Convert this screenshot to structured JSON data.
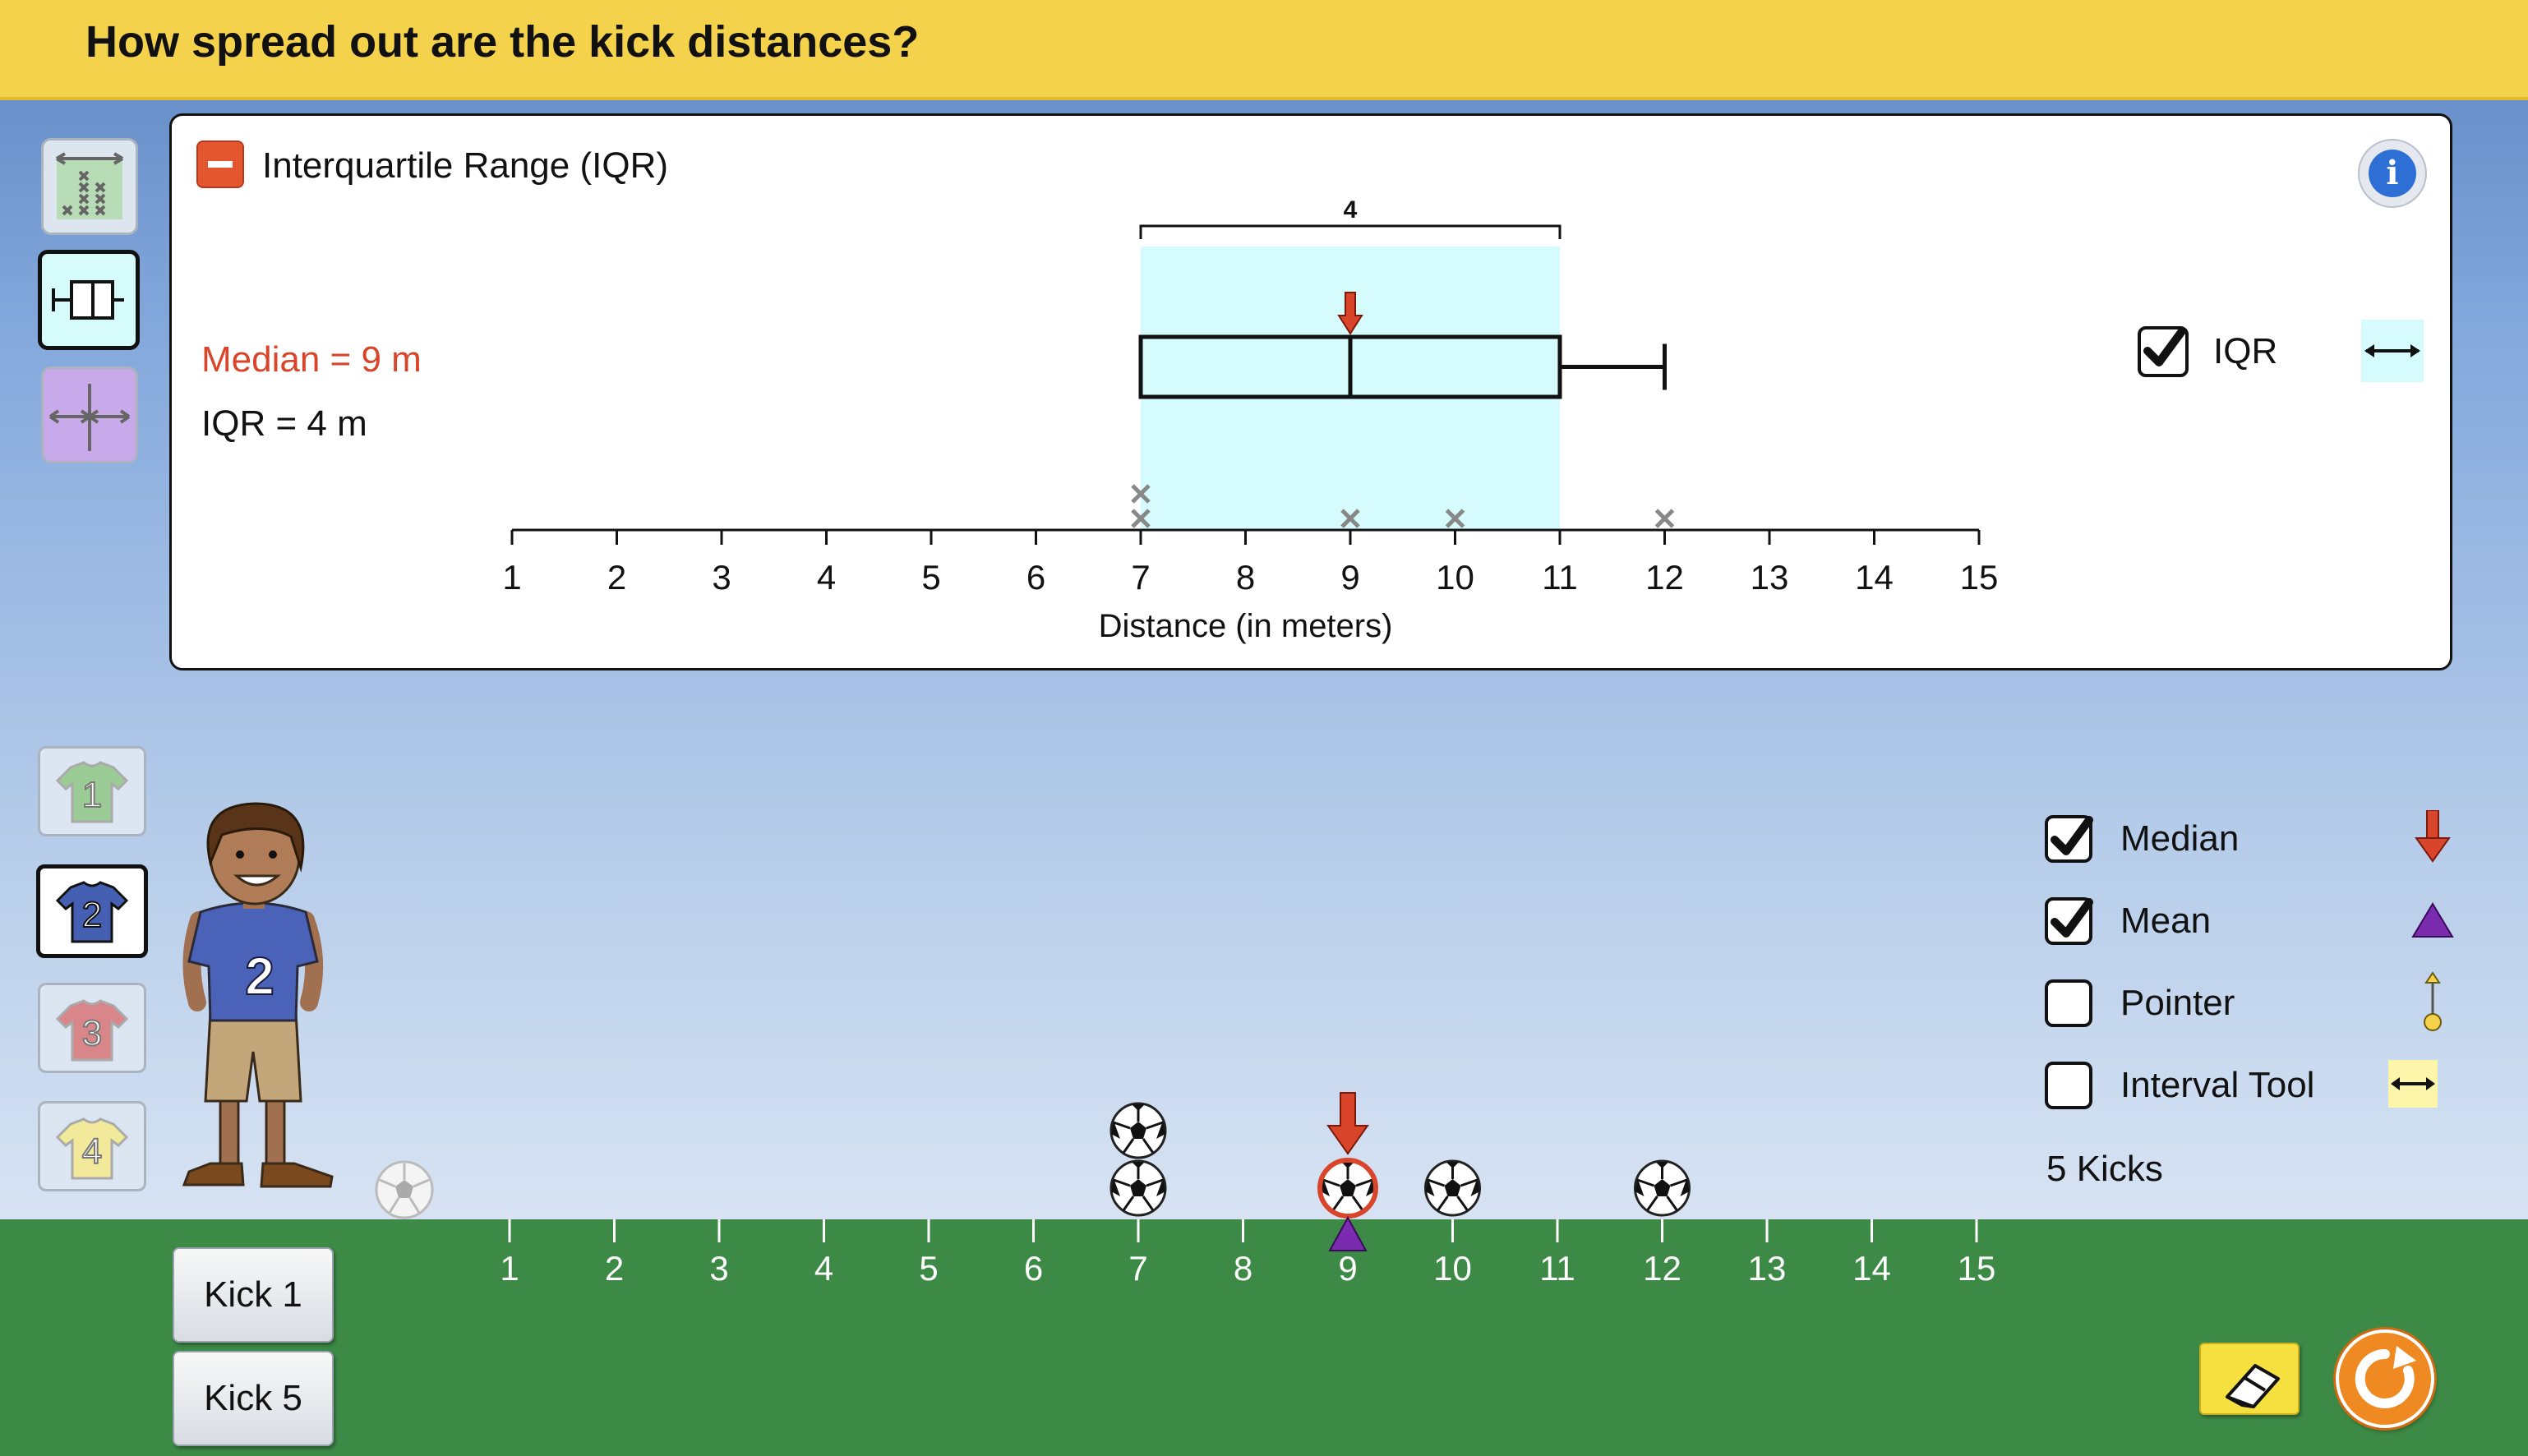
{
  "header": {
    "title": "How spread out are the kick distances?"
  },
  "panel": {
    "title": "Interquartile Range (IQR)",
    "median_text": "Median = 9 m",
    "iqr_text": "IQR = 4 m",
    "iqr_bracket_value": "4",
    "iqr_checkbox_label": "IQR",
    "iqr_checked": true,
    "axis_label": "Distance (in meters)",
    "ticks": [
      "1",
      "2",
      "3",
      "4",
      "5",
      "6",
      "7",
      "8",
      "9",
      "10",
      "11",
      "12",
      "13",
      "14",
      "15"
    ],
    "colors": {
      "iqr_band": "#d5fbfc",
      "median": "#d9452a",
      "header": "#f5d24b"
    }
  },
  "chart_data": {
    "type": "scatter",
    "xlabel": "Distance (in meters)",
    "xlim": [
      1,
      15
    ],
    "points": [
      7,
      7,
      9,
      10,
      12
    ],
    "box": {
      "q1": 7,
      "median": 9,
      "q3": 11,
      "min": 7,
      "max": 12
    },
    "iqr": 4
  },
  "side_tools": [
    {
      "name": "dot-plot-icon"
    },
    {
      "name": "box-plot-icon",
      "selected": true
    },
    {
      "name": "range-icon"
    }
  ],
  "players": [
    {
      "number": "1",
      "color": "#9ccc95"
    },
    {
      "number": "2",
      "color": "#4560b3",
      "selected": true
    },
    {
      "number": "3",
      "color": "#d9868a"
    },
    {
      "number": "4",
      "color": "#f2ea9a"
    }
  ],
  "player_jersey": "2",
  "field": {
    "ticks": [
      "1",
      "2",
      "3",
      "4",
      "5",
      "6",
      "7",
      "8",
      "9",
      "10",
      "11",
      "12",
      "13",
      "14",
      "15"
    ],
    "balls": [
      7,
      7,
      9,
      10,
      12
    ],
    "median": 9,
    "mean": 9
  },
  "kick_buttons": {
    "kick1": "Kick 1",
    "kick5": "Kick 5"
  },
  "legend": {
    "median": {
      "label": "Median",
      "checked": true
    },
    "mean": {
      "label": "Mean",
      "checked": true
    },
    "pointer": {
      "label": "Pointer",
      "checked": false
    },
    "interval": {
      "label": "Interval Tool",
      "checked": false
    },
    "kicks_count": "5 Kicks"
  }
}
